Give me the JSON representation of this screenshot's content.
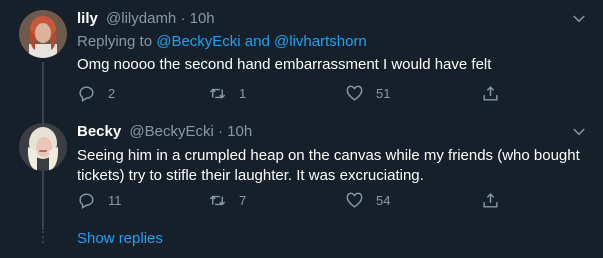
{
  "tweets": [
    {
      "name": "lily",
      "handle": "@lilydamh",
      "sep": " · ",
      "time": "10h",
      "replying_prefix": "Replying to ",
      "replying_to_1": "@BeckyEcki",
      "replying_and": " and ",
      "replying_to_2": "@livhartshorn",
      "text": "Omg noooo the second hand embarrassment I would have felt",
      "replies": "2",
      "retweets": "1",
      "likes": "51"
    },
    {
      "name": "Becky",
      "handle": "@BeckyEcki",
      "sep": " · ",
      "time": "10h",
      "text": "Seeing him in a crumpled heap on the canvas while my friends (who bought tickets) try to stifle their laughter. It was excruciating.",
      "replies": "11",
      "retweets": "7",
      "likes": "54"
    }
  ],
  "show_replies": "Show replies",
  "colors": {
    "background": "#15202b",
    "secondary": "#8899a6",
    "accent": "#1da1f2"
  },
  "icons": [
    "avatar",
    "chevron-down-icon",
    "reply-icon",
    "retweet-icon",
    "like-icon",
    "share-icon"
  ]
}
